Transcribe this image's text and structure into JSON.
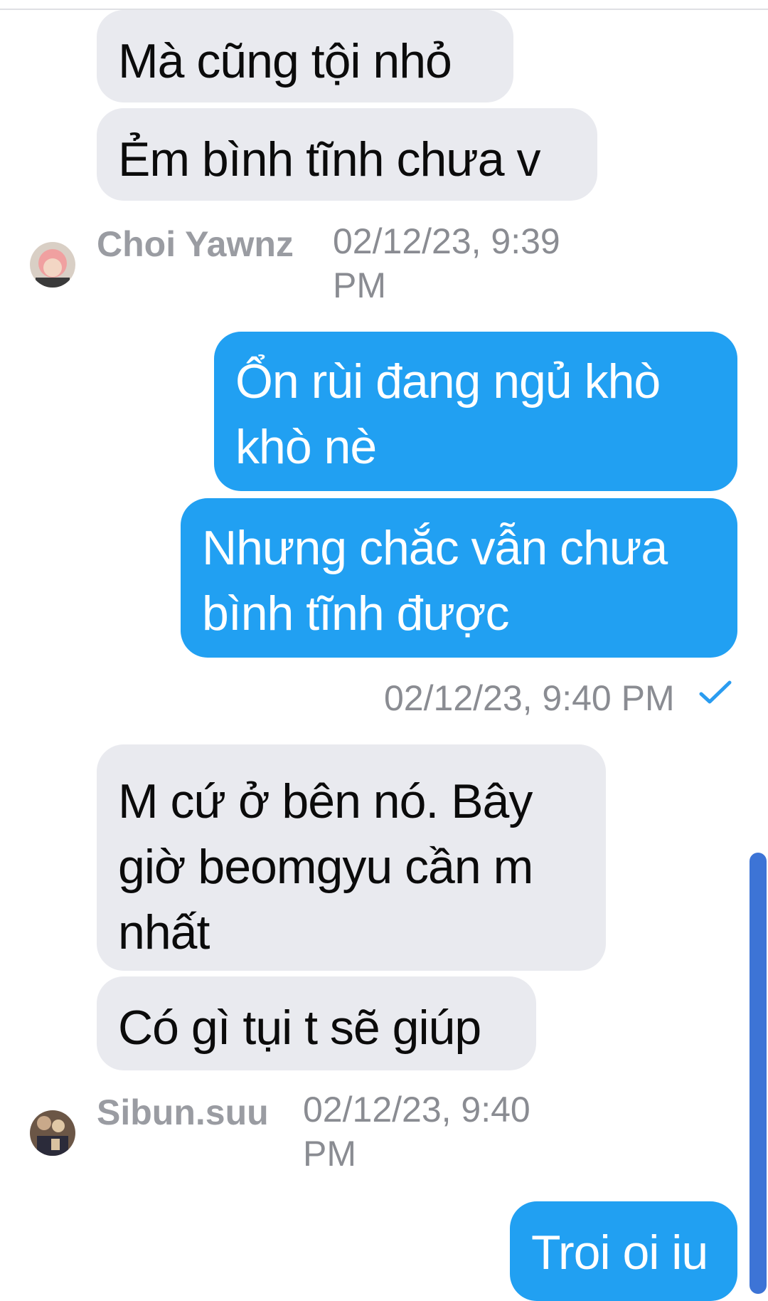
{
  "messages_top": [
    {
      "text": "Mà cũng tội nhỏ"
    },
    {
      "text": "Ẻm bình tĩnh chưa v"
    }
  ],
  "sender1": {
    "name": "Choi Yawnz",
    "time_line1": "02/12/23, 9:39",
    "time_line2": "PM",
    "avatar_icon": "avatar-photo-pink-hair"
  },
  "outgoing1": [
    {
      "text": "Ổn rùi đang ngủ khò\nkhò nè"
    },
    {
      "text": "Nhưng chắc vẫn chưa\nbình tĩnh được"
    }
  ],
  "outgoing1_status": {
    "time": "02/12/23, 9:40 PM",
    "icon": "check-icon"
  },
  "messages_mid": [
    {
      "text": "M cứ ở bên nó. Bây\ngiờ beomgyu cần m\nnhất"
    },
    {
      "text": "Có gì tụi t sẽ giúp"
    }
  ],
  "sender2": {
    "name": "Sibun.suu",
    "time_line1": "02/12/23, 9:40",
    "time_line2": "PM",
    "avatar_icon": "avatar-photo-dark"
  },
  "outgoing2": [
    {
      "text": "Troi oi iu"
    }
  ],
  "colors": {
    "incoming_bubble": "#e9eaef",
    "outgoing_bubble": "#21a0f2",
    "meta_text": "#8e9197",
    "scrollbar": "#3d74d6"
  }
}
